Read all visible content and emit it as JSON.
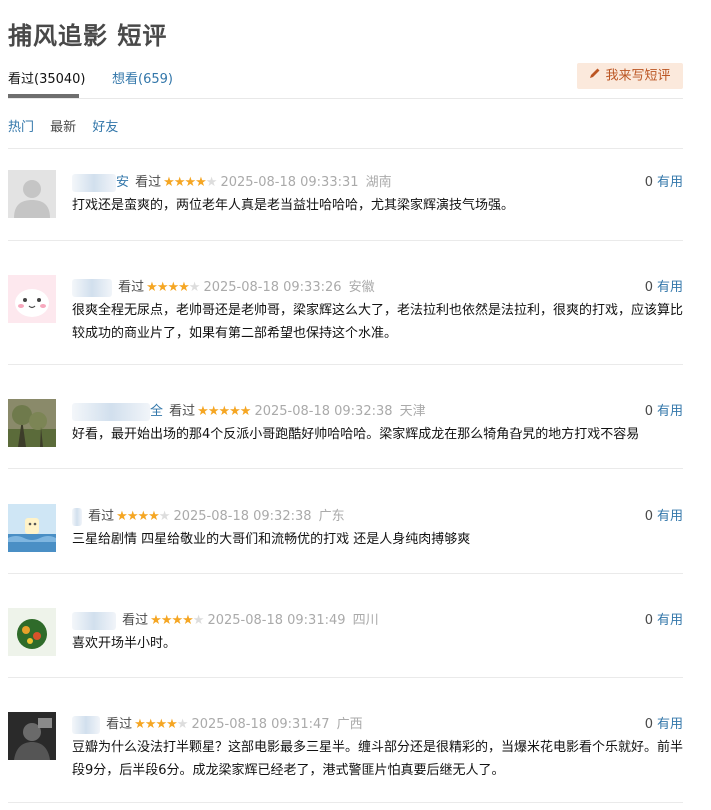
{
  "page": {
    "title": "捕风追影 短评"
  },
  "tabs": {
    "watched": "看过(35040)",
    "want": "想看(659)",
    "write_button": "我来写短评"
  },
  "sorts": {
    "hot": "热门",
    "latest": "最新",
    "friends": "好友"
  },
  "icons": {
    "pen": "pencil-icon"
  },
  "colors": {
    "link": "#3377aa",
    "star": "#f5a623",
    "button_bg": "#fbe9dc",
    "button_text": "#bb5522"
  },
  "comments": [
    {
      "name_visible": "安",
      "status": "看过",
      "rating": 4,
      "time": "2025-08-18 09:33:31",
      "location": "湖南",
      "votes": "0",
      "useful_label": "有用",
      "text": "打戏还是蛮爽的，两位老年人真是老当益壮哈哈哈，尤其梁家辉演技气场强。"
    },
    {
      "name_visible": "",
      "status": "看过",
      "rating": 4,
      "time": "2025-08-18 09:33:26",
      "location": "安徽",
      "votes": "0",
      "useful_label": "有用",
      "text": "很爽全程无尿点，老帅哥还是老帅哥，梁家辉这么大了，老法拉利也依然是法拉利，很爽的打戏，应该算比较成功的商业片了，如果有第二部希望也保持这个水准。"
    },
    {
      "name_visible": "全",
      "status": "看过",
      "rating": 5,
      "time": "2025-08-18 09:32:38",
      "location": "天津",
      "votes": "0",
      "useful_label": "有用",
      "text": "好看，最开始出场的那4个反派小哥跑酷好帅哈哈哈。梁家辉成龙在那么犄角旮旯的地方打戏不容易"
    },
    {
      "name_visible": "",
      "status": "看过",
      "rating": 4,
      "time": "2025-08-18 09:32:38",
      "location": "广东",
      "votes": "0",
      "useful_label": "有用",
      "text": "三星给剧情 四星给敬业的大哥们和流畅优的打戏 还是人身纯肉搏够爽"
    },
    {
      "name_visible": "",
      "status": "看过",
      "rating": 4,
      "time": "2025-08-18 09:31:49",
      "location": "四川",
      "votes": "0",
      "useful_label": "有用",
      "text": "喜欢开场半小时。"
    },
    {
      "name_visible": "",
      "status": "看过",
      "rating": 4,
      "time": "2025-08-18 09:31:47",
      "location": "广西",
      "votes": "0",
      "useful_label": "有用",
      "text": "豆瓣为什么没法打半颗星？这部电影最多三星半。缠斗部分还是很精彩的，当爆米花电影看个乐就好。前半段9分，后半段6分。成龙梁家辉已经老了，港式警匪片怕真要后继无人了。"
    }
  ]
}
